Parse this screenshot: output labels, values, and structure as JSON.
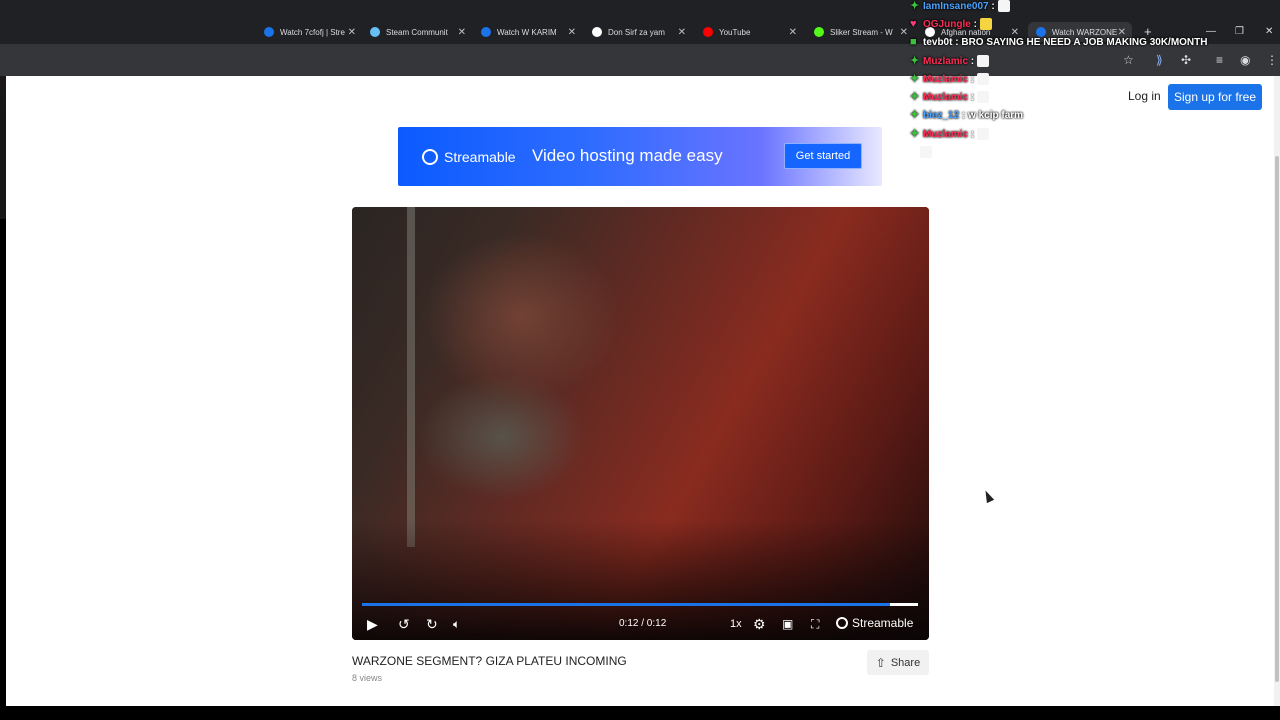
{
  "browser": {
    "tabs": [
      {
        "label": "Watch 7cfofj | Stre",
        "color": "#1a73e8"
      },
      {
        "label": "Steam Communit",
        "color": "#66c0f4"
      },
      {
        "label": "Watch W KARIM",
        "color": "#1a73e8"
      },
      {
        "label": "Don Sirf za yam",
        "color": "#ffffff"
      },
      {
        "label": "YouTube",
        "color": "#ff0000"
      },
      {
        "label": "Sliker Stream - W",
        "color": "#53fc18"
      },
      {
        "label": "Afghan nation",
        "color": "#ffffff"
      },
      {
        "label": "Watch WARZONE",
        "color": "#1a73e8"
      }
    ]
  },
  "header": {
    "login_label": "Log in",
    "signup_label": "Sign up for free"
  },
  "banner": {
    "brand": "Streamable",
    "tagline": "Video hosting made easy",
    "cta_label": "Get started"
  },
  "player": {
    "timecode": "0:12 / 0:12",
    "speed": "1x",
    "brand": "Streamable",
    "progress": 0.95
  },
  "video": {
    "title": "WARZONE SEGMENT? GIZA PLATEU INCOMING",
    "views": "8 views",
    "share_label": "Share"
  },
  "chat": [
    {
      "user": "IamInsane007",
      "color": "#4aa3ff",
      "text": ""
    },
    {
      "user": "OGJungle",
      "color": "#ff2d55",
      "text": ""
    },
    {
      "user": "tevb0t",
      "color": "#ffffff",
      "text": "BRO SAYING HE NEED A JOB MAKING 30K/MONTH"
    },
    {
      "user": "Muzlamic",
      "color": "#ff2d55",
      "text": ""
    },
    {
      "user": "Muzlamic",
      "color": "#ff2d55",
      "text": ""
    },
    {
      "user": "Muzlamic",
      "color": "#ff2d55",
      "text": ""
    },
    {
      "user": "biez_12",
      "color": "#4aa3ff",
      "text": "w kcip farm"
    },
    {
      "user": "Muzlamic",
      "color": "#ff2d55",
      "text": ""
    }
  ]
}
